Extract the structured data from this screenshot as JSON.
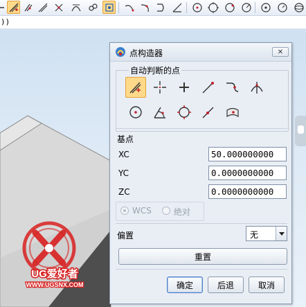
{
  "command_line": {
    "text": "))"
  },
  "dialog": {
    "title": "点构造器",
    "close_symbol": "✕",
    "auto_group_label": "自动判断的点",
    "point_types": [
      "自动判断的点",
      "光标位置",
      "现有点",
      "终点",
      "控制点",
      "交点",
      "圆弧中心/椭圆中心/球心",
      "圆弧/椭圆上的角度",
      "象限点",
      "点在曲线/边上",
      "点在曲面上"
    ],
    "base_point_label": "基点",
    "coords": [
      {
        "label": "XC",
        "value": "50.000000000"
      },
      {
        "label": "YC",
        "value": "0.0000000000"
      },
      {
        "label": "ZC",
        "value": "0.0000000000"
      }
    ],
    "csys": {
      "option_wcs": "WCS",
      "option_abs": "绝对",
      "selected": "WCS"
    },
    "offset": {
      "label": "偏置",
      "value": "无"
    },
    "reset_button": "重置",
    "ok_button": "确定",
    "back_button": "后退",
    "cancel_button": "取消"
  },
  "watermark": {
    "brand": "UG爱好者",
    "url": "WWW.UGSNX.COM"
  },
  "colors": {
    "accent": "#ffd98a",
    "accent_border": "#e3a23a",
    "icon_red": "#c4202a",
    "watermark_red": "#d82020",
    "dialog_bg": "#e9eef5"
  }
}
